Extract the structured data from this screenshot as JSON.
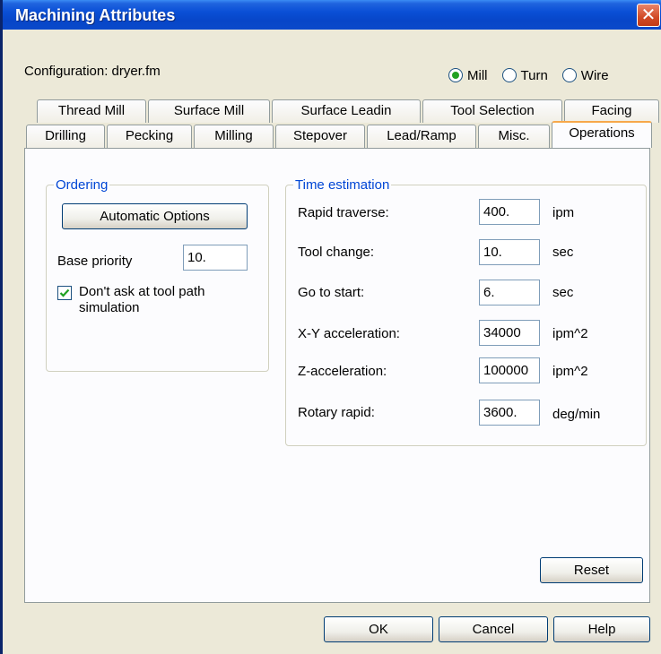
{
  "window": {
    "title": "Machining Attributes",
    "close_glyph": "✕"
  },
  "configuration": {
    "label": "Configuration: dryer.fm"
  },
  "mode": {
    "options": [
      {
        "label": "Mill",
        "checked": true
      },
      {
        "label": "Turn",
        "checked": false
      },
      {
        "label": "Wire",
        "checked": false
      }
    ]
  },
  "tabs": {
    "row_back": [
      "Thread Mill",
      "Surface Mill",
      "Surface Leadin",
      "Tool Selection",
      "Facing"
    ],
    "row_front": [
      "Drilling",
      "Pecking",
      "Milling",
      "Stepover",
      "Lead/Ramp",
      "Misc.",
      "Operations"
    ],
    "active": "Operations"
  },
  "ordering": {
    "legend": "Ordering",
    "automatic_options_label": "Automatic Options",
    "base_priority_label": "Base priority",
    "base_priority_value": "10.",
    "dont_ask_label_line1": "Don't ask at tool path",
    "dont_ask_label_line2": "simulation",
    "dont_ask_checked": true
  },
  "time_estimation": {
    "legend": "Time estimation",
    "rows": [
      {
        "label": "Rapid traverse:",
        "value": "400.",
        "unit": "ipm"
      },
      {
        "label": "Tool change:",
        "value": "10.",
        "unit": "sec"
      },
      {
        "label": "Go to start:",
        "value": "6.",
        "unit": "sec"
      },
      {
        "label": "X-Y acceleration:",
        "value": "34000",
        "unit": "ipm^2"
      },
      {
        "label": "Z-acceleration:",
        "value": "100000",
        "unit": "ipm^2"
      },
      {
        "label": "Rotary rapid:",
        "value": "3600.",
        "unit": "deg/min"
      }
    ]
  },
  "buttons": {
    "reset": "Reset",
    "ok": "OK",
    "cancel": "Cancel",
    "help": "Help"
  }
}
